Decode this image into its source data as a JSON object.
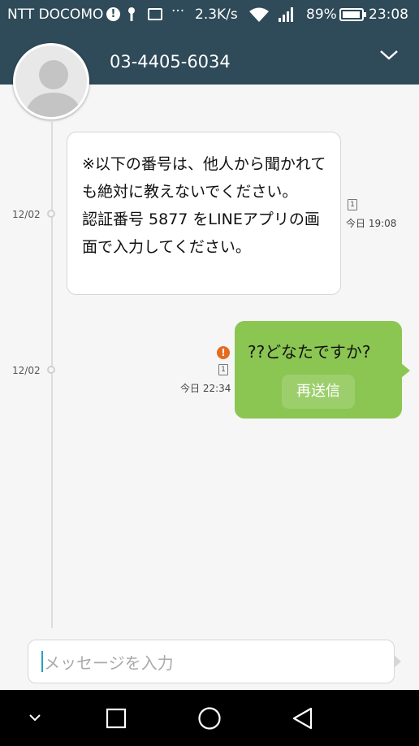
{
  "status_bar": {
    "carrier": "NTT DOCOMO",
    "net_speed": "2.3K/s",
    "battery": "89%",
    "time": "23:08",
    "icons": [
      "alert-icon",
      "key-icon",
      "image-icon",
      "more-icon",
      "wifi-icon",
      "signal-icon",
      "battery-icon"
    ]
  },
  "header": {
    "contact": "03-4405-6034"
  },
  "messages": [
    {
      "date": "12/02",
      "direction": "incoming",
      "text": "※以下の番号は、他人から聞かれても絶対に教えないでください。\n認証番号 5877 をLINEアプリの画面で入力してください。",
      "sim": "1",
      "time": "今日 19:08"
    },
    {
      "date": "12/02",
      "direction": "outgoing",
      "text": "??どなたですか?",
      "resend_label": "再送信",
      "sim": "1",
      "time": "今日 22:34",
      "status": "failed"
    }
  ],
  "composer": {
    "placeholder": "メッセージを入力"
  },
  "navigation": [
    "collapse-icon",
    "recents-icon",
    "home-icon",
    "back-icon"
  ],
  "colors": {
    "header": "#2f4a58",
    "outgoing_bubble": "#8bc653",
    "error": "#e56b1f"
  }
}
